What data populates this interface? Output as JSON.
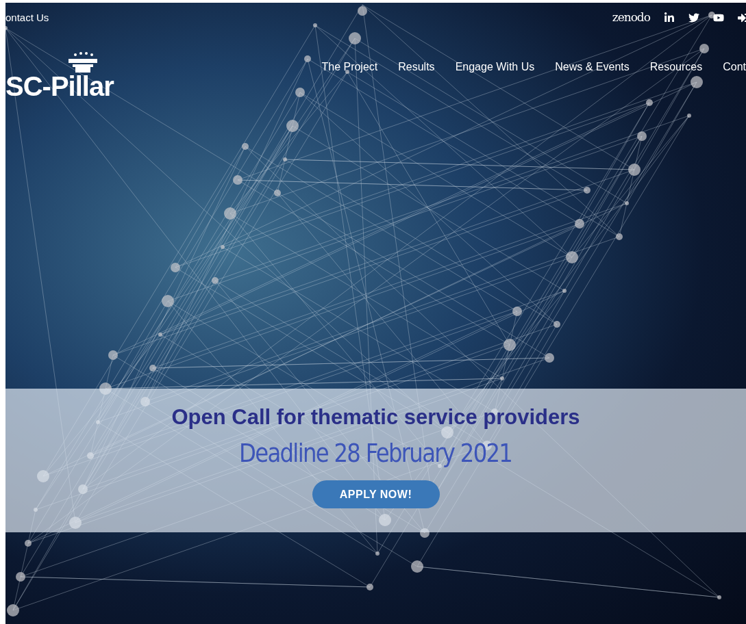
{
  "top_bar": {
    "contact_link": "ontact Us",
    "zenodo": "zenodo"
  },
  "logo": {
    "text": "SC-Pillar"
  },
  "nav": {
    "items": [
      "The Project",
      "Results",
      "Engage With Us",
      "News & Events",
      "Resources",
      "Cont"
    ]
  },
  "banner": {
    "title": "Open Call for thematic service providers",
    "deadline": "Deadline 28 February 2021",
    "button": "APPLY NOW!"
  }
}
